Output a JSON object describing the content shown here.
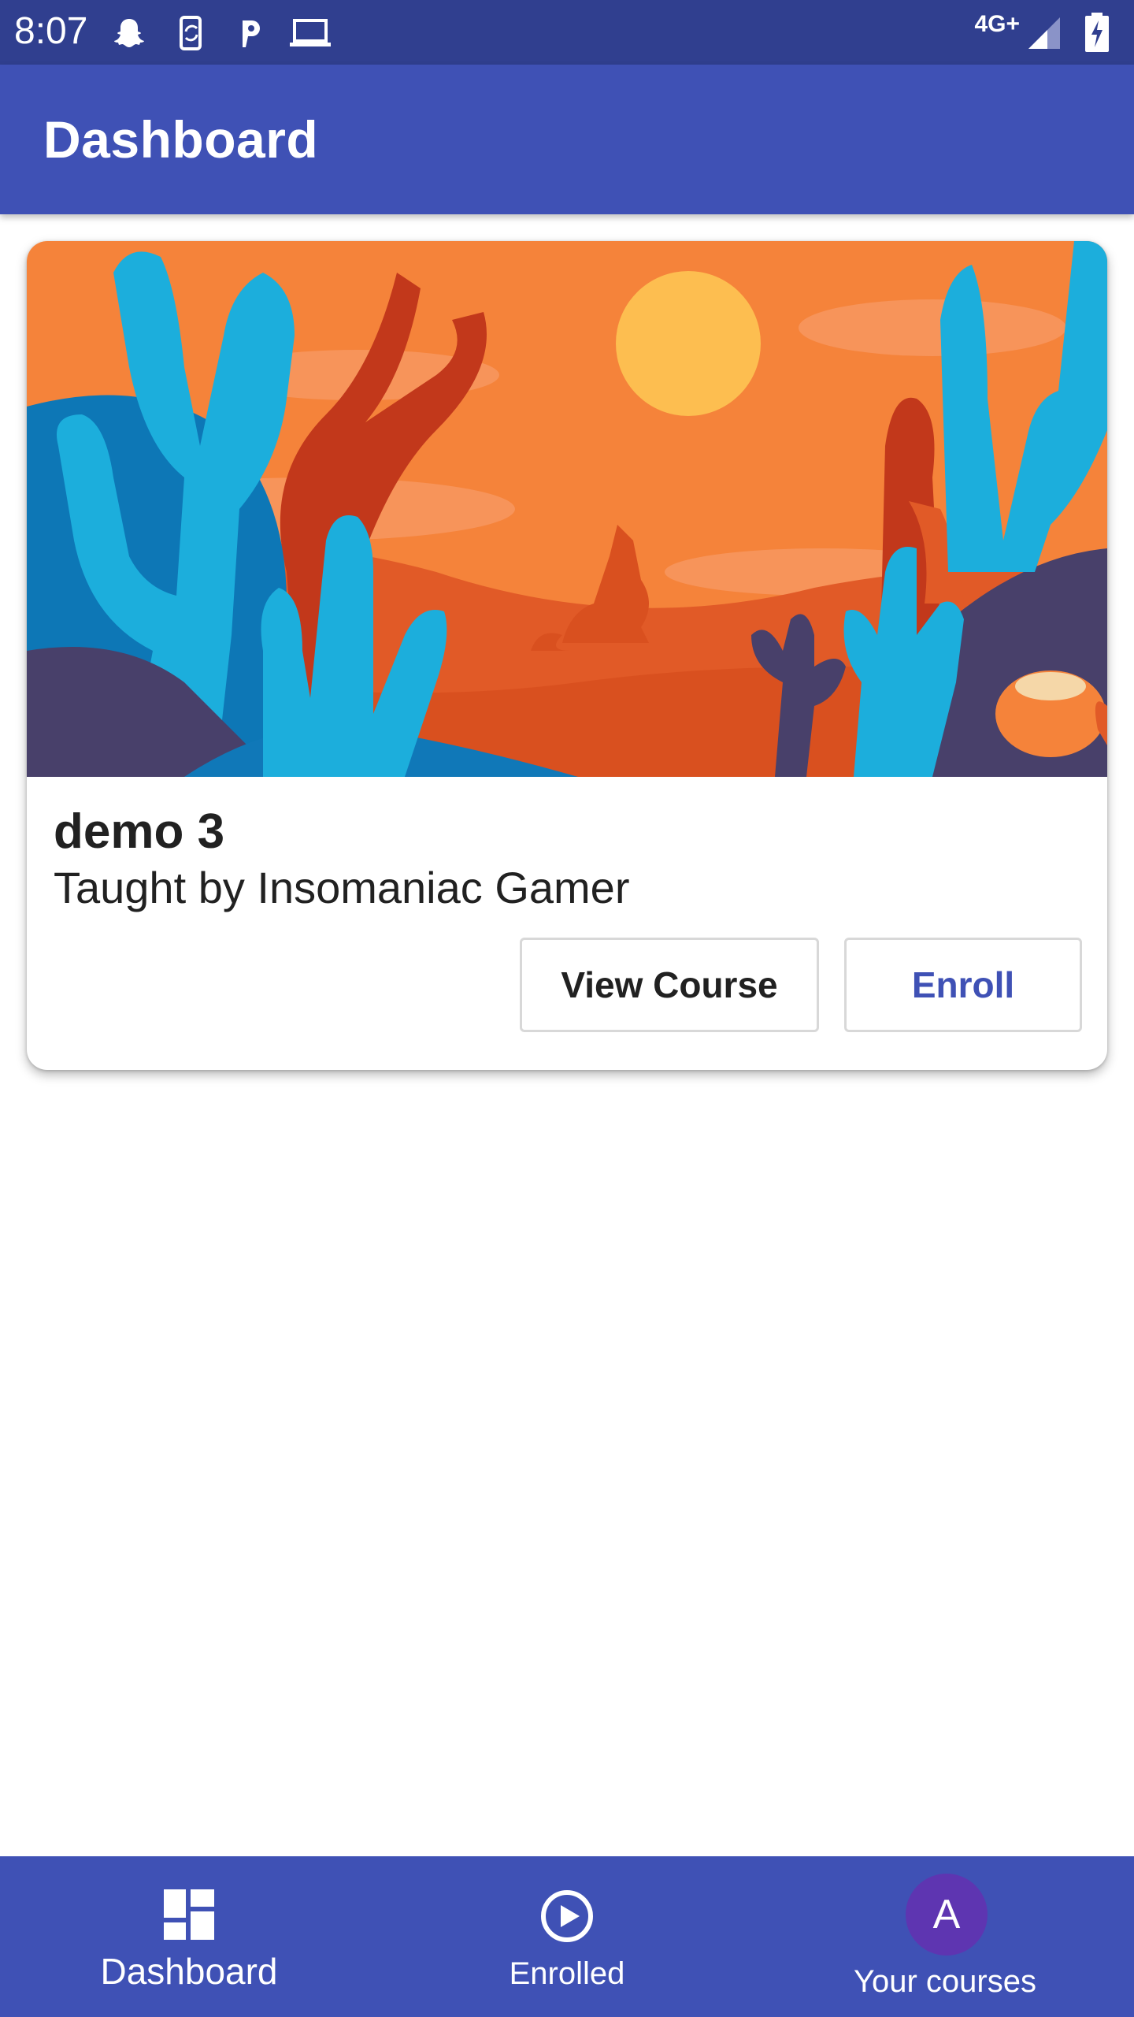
{
  "status_bar": {
    "time": "8:07",
    "network": "4G+",
    "icons": [
      "snapchat-icon",
      "phone-sync-icon",
      "parking-icon",
      "laptop-icon",
      "signal-icon",
      "battery-charging-icon"
    ]
  },
  "app_bar": {
    "title": "Dashboard"
  },
  "course_card": {
    "image": "desert-cactus-illustration",
    "title": "demo 3",
    "subtitle": "Taught by Insomaniac Gamer",
    "view_button": "View Course",
    "enroll_button": "Enroll"
  },
  "bottom_nav": {
    "items": [
      {
        "label": "Dashboard",
        "icon": "dashboard-icon"
      },
      {
        "label": "Enrolled",
        "icon": "play-circle-icon"
      },
      {
        "label": "Your courses",
        "icon": "avatar",
        "avatar_letter": "A"
      }
    ]
  },
  "colors": {
    "primary": "#3F51B5",
    "status_bar": "#303F8F",
    "avatar": "#5E35B1"
  }
}
